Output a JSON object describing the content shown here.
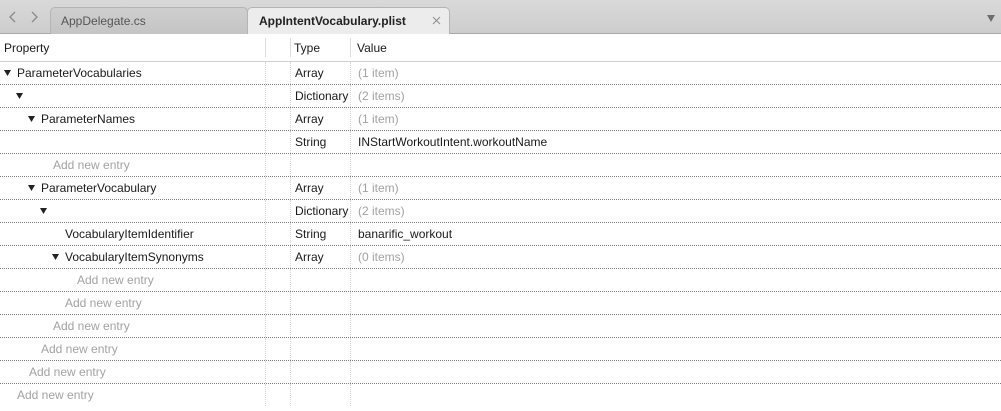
{
  "tabs": [
    {
      "label": "AppDelegate.cs",
      "active": false
    },
    {
      "label": "AppIntentVocabulary.plist",
      "active": true
    }
  ],
  "columns": {
    "property": "Property",
    "type": "Type",
    "value": "Value"
  },
  "rows": [
    {
      "depth": 0,
      "expanded": true,
      "key": "ParameterVocabularies",
      "type": "Array",
      "value": "(1 item)",
      "muted": true
    },
    {
      "depth": 1,
      "expanded": true,
      "key": "",
      "type": "Dictionary",
      "value": "(2 items)",
      "muted": true
    },
    {
      "depth": 2,
      "expanded": true,
      "key": "ParameterNames",
      "type": "Array",
      "value": "(1 item)",
      "muted": true
    },
    {
      "depth": 3,
      "expanded": null,
      "key": "",
      "type": "String",
      "value": "INStartWorkoutIntent.workoutName",
      "muted": false
    },
    {
      "depth": 3,
      "add": true,
      "key": "Add new entry",
      "type": "",
      "value": ""
    },
    {
      "depth": 2,
      "expanded": true,
      "key": "ParameterVocabulary",
      "type": "Array",
      "value": "(1 item)",
      "muted": true
    },
    {
      "depth": 3,
      "expanded": true,
      "key": "",
      "type": "Dictionary",
      "value": "(2 items)",
      "muted": true
    },
    {
      "depth": 4,
      "expanded": null,
      "key": "VocabularyItemIdentifier",
      "type": "String",
      "value": "banarific_workout",
      "muted": false
    },
    {
      "depth": 4,
      "expanded": true,
      "key": "VocabularyItemSynonyms",
      "type": "Array",
      "value": "(0 items)",
      "muted": true
    },
    {
      "depth": 5,
      "add": true,
      "key": "Add new entry",
      "type": "",
      "value": ""
    },
    {
      "depth": 4,
      "add": true,
      "key": "Add new entry",
      "type": "",
      "value": ""
    },
    {
      "depth": 3,
      "add": true,
      "key": "Add new entry",
      "type": "",
      "value": ""
    },
    {
      "depth": 2,
      "add": true,
      "key": "Add new entry",
      "type": "",
      "value": ""
    },
    {
      "depth": 1,
      "add": true,
      "key": "Add new entry",
      "type": "",
      "value": ""
    },
    {
      "depth": 0,
      "add": true,
      "key": "Add new entry",
      "type": "",
      "value": ""
    }
  ],
  "icons": {
    "back": "chevron-left-icon",
    "forward": "chevron-right-icon",
    "close": "close-icon",
    "overflow": "chevron-down-icon",
    "disclosure": "disclosure-triangle-icon"
  },
  "colors": {
    "muted_text": "#a2a2a2",
    "tab_bar": "#d3d3d3",
    "active_tab": "#ececec"
  }
}
